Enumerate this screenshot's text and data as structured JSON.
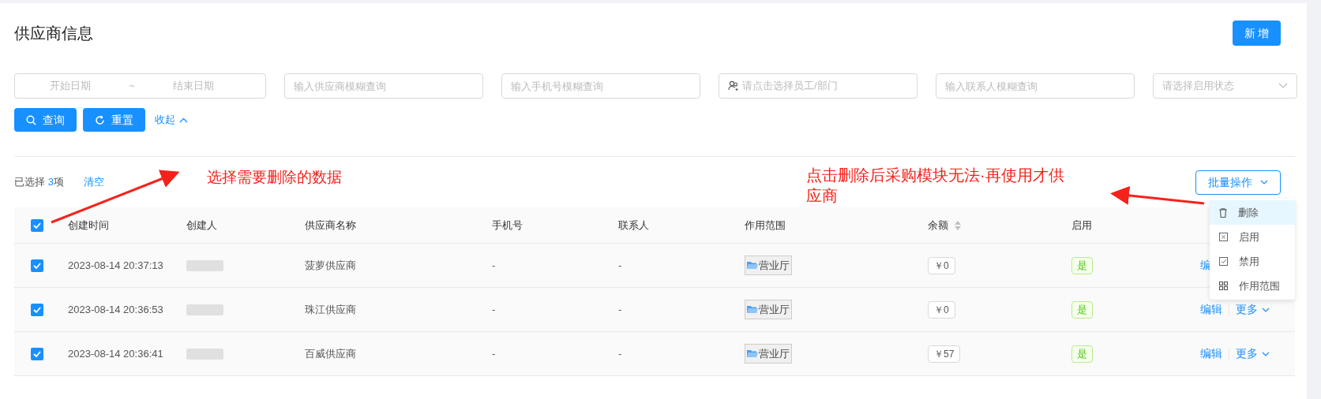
{
  "page": {
    "title": "供应商信息",
    "add_button": "新 增"
  },
  "filters": {
    "date_start": {
      "placeholder": "开始日期"
    },
    "date_separator": "~",
    "date_end": {
      "placeholder": "结束日期"
    },
    "supplier": {
      "placeholder": "输入供应商模糊查询"
    },
    "phone": {
      "placeholder": "输入手机号模糊查询"
    },
    "staff": {
      "placeholder": "请点击选择员工/部门"
    },
    "contact": {
      "placeholder": "输入联系人模糊查询"
    },
    "status": {
      "placeholder": "请选择启用状态"
    }
  },
  "actions": {
    "search": "查询",
    "reset": "重置",
    "collapse": "收起"
  },
  "selection": {
    "prefix": "已选择 ",
    "count": "3",
    "suffix": "项",
    "clear": "清空"
  },
  "batch_button": "批量操作",
  "batch_menu": [
    {
      "label": "删除",
      "kind": "delete",
      "selected": true
    },
    {
      "label": "启用",
      "kind": "enable",
      "selected": false
    },
    {
      "label": "禁用",
      "kind": "disable",
      "selected": false
    },
    {
      "label": "作用范围",
      "kind": "scope",
      "selected": false
    }
  ],
  "annotations": [
    {
      "text": "选择需要删除的数据"
    },
    {
      "text": "点击删除后采购模块无法·再使用才供应商"
    }
  ],
  "table": {
    "all_checked": true,
    "columns": [
      "创建时间",
      "创建人",
      "供应商名称",
      "手机号",
      "联系人",
      "作用范围",
      "余额",
      "启用"
    ],
    "rows": [
      {
        "checked": true,
        "created": "2023-08-14 20:37:13",
        "creator_redacted": true,
        "name": "菠萝供应商",
        "phone": "-",
        "contact": "-",
        "scope": "营业厅",
        "balance": "￥0",
        "enabled": "是",
        "edit": "编",
        "more": null
      },
      {
        "checked": true,
        "created": "2023-08-14 20:36:53",
        "creator_redacted": true,
        "name": "珠江供应商",
        "phone": "-",
        "contact": "-",
        "scope": "营业厅",
        "balance": "￥0",
        "enabled": "是",
        "edit": "编辑",
        "more": "更多"
      },
      {
        "checked": true,
        "created": "2023-08-14 20:36:41",
        "creator_redacted": true,
        "name": "百威供应商",
        "phone": "-",
        "contact": "-",
        "scope": "营业厅",
        "balance": "￥57",
        "enabled": "是",
        "edit": "编辑",
        "more": "更多"
      }
    ]
  }
}
